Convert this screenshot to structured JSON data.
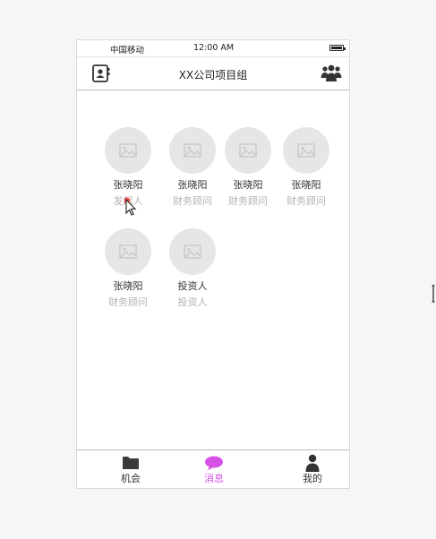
{
  "status_bar": {
    "carrier": "中国移动",
    "time": "12:00 AM"
  },
  "header": {
    "title": "XX公司项目组",
    "left_icon": "contact-card-icon",
    "right_icon": "group-users-icon"
  },
  "members": [
    {
      "name": "张晓阳",
      "role": "发起人"
    },
    {
      "name": "张晓阳",
      "role": "财务顾问"
    },
    {
      "name": "张晓阳",
      "role": "财务顾问"
    },
    {
      "name": "张晓阳",
      "role": "财务顾问"
    },
    {
      "name": "张晓阳",
      "role": "财务顾问"
    },
    {
      "name": "投资人",
      "role": "投资人"
    }
  ],
  "tabbar": {
    "items": [
      {
        "label": "机会",
        "icon": "folder-icon",
        "active": false
      },
      {
        "label": "消息",
        "icon": "chat-bubble-icon",
        "active": true
      },
      {
        "label": "我的",
        "icon": "user-icon",
        "active": false
      }
    ]
  },
  "colors": {
    "active_tab": "#d452e6",
    "inactive_tab": "#333333",
    "avatar_bg": "#e6e6e6",
    "role_text": "#b3b3b3"
  }
}
